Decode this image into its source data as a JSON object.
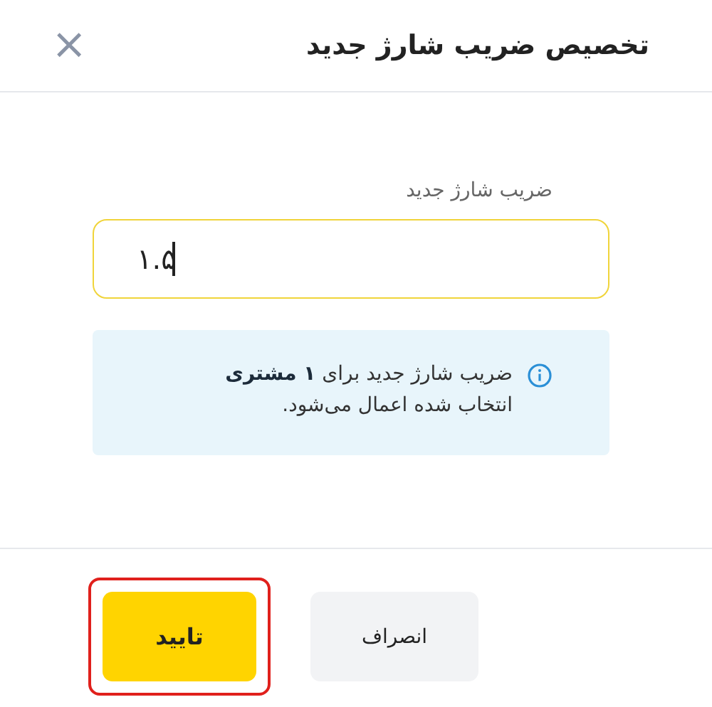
{
  "dialog": {
    "title": "تخصیص ضریب شارژ جدید",
    "close": "×"
  },
  "field": {
    "label": "ضریب شارژ جدید",
    "value": "۱.۵",
    "focused": true
  },
  "info": {
    "text": "ضریب شارژ جدید برای **۱ مشتری** انتخاب شده اعمال می‌شود."
  },
  "buttons": [
    {
      "kind": "secondary",
      "label": "انصراف",
      "highlighted": false
    },
    {
      "kind": "primary",
      "label": "تایید",
      "highlighted": true
    }
  ]
}
